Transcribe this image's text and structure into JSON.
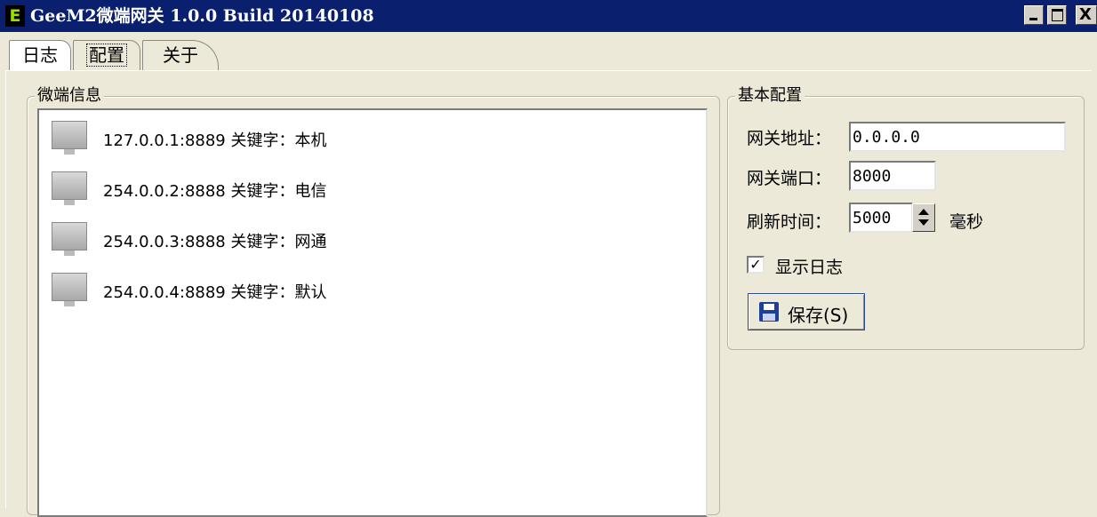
{
  "window": {
    "icon_letter": "E",
    "title": "GeeM2微端网关 1.0.0 Build 20140108",
    "minimize": "_",
    "close": "X"
  },
  "tabs": [
    {
      "label": "日志"
    },
    {
      "label": "配置",
      "selected": true
    },
    {
      "label": "关于"
    }
  ],
  "client_info": {
    "legend": "微端信息",
    "items": [
      {
        "text": "127.0.0.1:8889 关键字：本机"
      },
      {
        "text": "254.0.0.2:8888 关键字：电信"
      },
      {
        "text": "254.0.0.3:8888 关键字：网通"
      },
      {
        "text": "254.0.0.4:8889 关键字：默认"
      }
    ]
  },
  "basic_config": {
    "legend": "基本配置",
    "gateway_address_label": "网关地址：",
    "gateway_address_value": "0.0.0.0",
    "gateway_port_label": "网关端口：",
    "gateway_port_value": "8000",
    "refresh_time_label": "刷新时间：",
    "refresh_time_value": "5000",
    "refresh_time_unit": "毫秒",
    "show_log_label": "显示日志",
    "show_log_checked": true,
    "show_log_mark": "✓",
    "save_label": "保存(S)"
  }
}
